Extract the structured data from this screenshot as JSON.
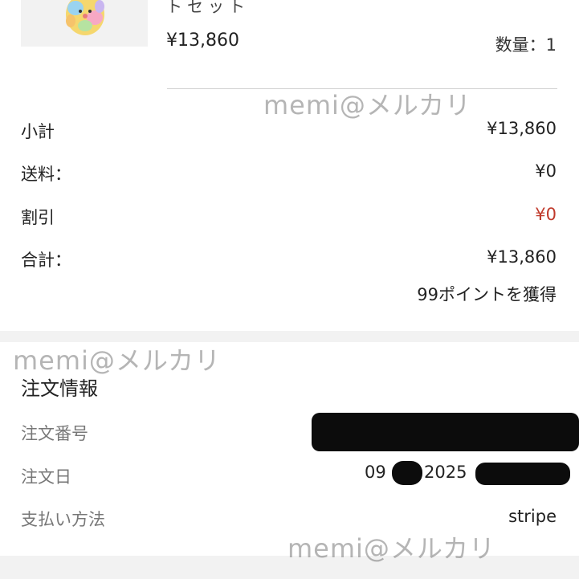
{
  "product": {
    "name_partial": "トセット",
    "price": "¥13,860",
    "quantity": "数量：1"
  },
  "summary": {
    "subtotal_label": "小計",
    "subtotal_value": "¥13,860",
    "shipping_label": "送料：",
    "shipping_value": "¥0",
    "discount_label": "割引",
    "discount_value": "¥0",
    "total_label": "合計：",
    "total_value": "¥13,860",
    "points": "99ポイントを獲得"
  },
  "order_info": {
    "title": "注文情報",
    "number_label": "注文番号",
    "date_label": "注文日",
    "date_prefix": "09",
    "date_year": "2025",
    "payment_label": "支払い方法",
    "payment_value": "stripe"
  },
  "watermark": "memi@メルカリ",
  "colors": {
    "discount": "#c0392b",
    "label_muted": "#777777",
    "section_gap": "#f2f2f2"
  }
}
